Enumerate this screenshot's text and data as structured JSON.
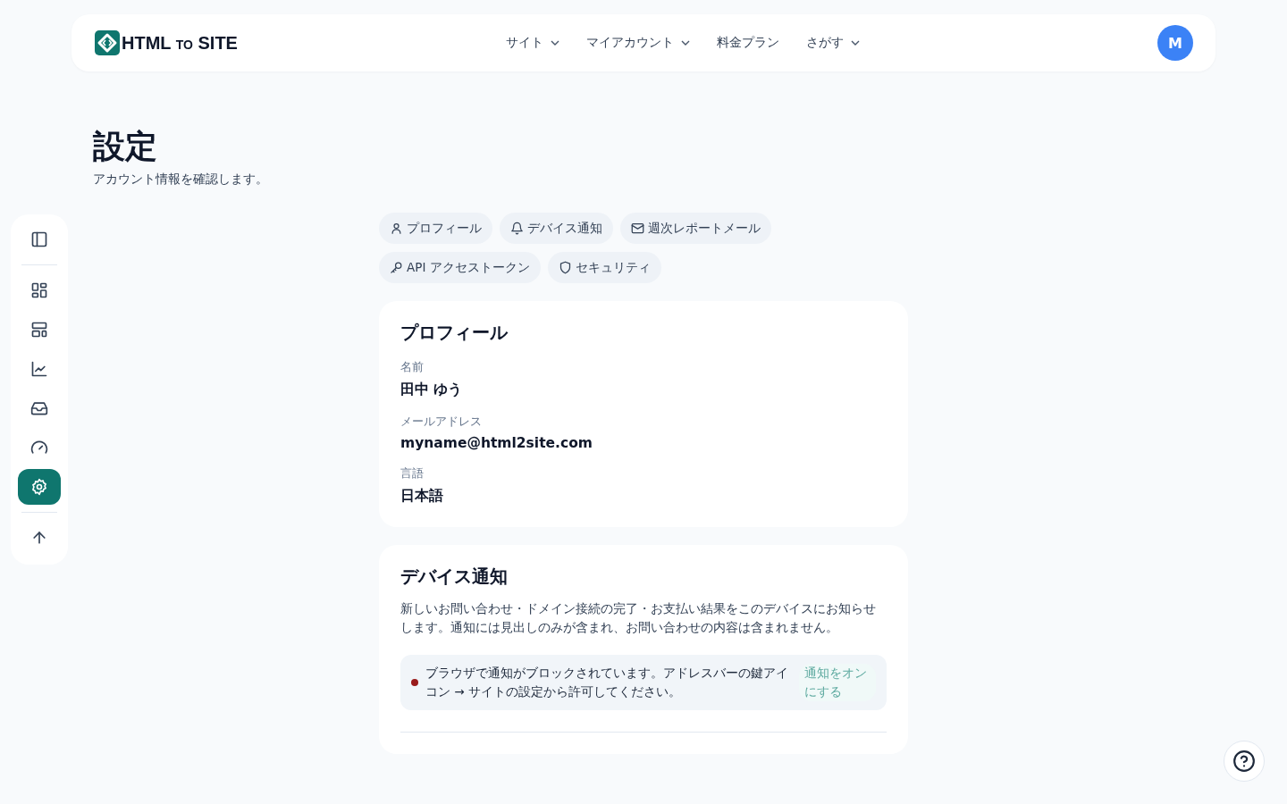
{
  "header": {
    "logo": {
      "main": "HTML",
      "small": "TO",
      "tail": "SITE"
    },
    "nav": [
      {
        "label": "サイト",
        "dropdown": true
      },
      {
        "label": "マイアカウント",
        "dropdown": true
      },
      {
        "label": "料金プラン",
        "dropdown": false
      },
      {
        "label": "さがす",
        "dropdown": true
      }
    ],
    "avatar": "M"
  },
  "page": {
    "title": "設定",
    "subtitle": "アカウント情報を確認します。"
  },
  "sidebar": {
    "groups": [
      [
        {
          "kind": "panel",
          "selected": false
        }
      ],
      [
        {
          "kind": "grid",
          "selected": false
        },
        {
          "kind": "layout",
          "selected": false
        },
        {
          "kind": "chart",
          "selected": false
        },
        {
          "kind": "inbox",
          "selected": false
        },
        {
          "kind": "gauge",
          "selected": false
        },
        {
          "kind": "settings",
          "selected": true
        }
      ],
      [
        {
          "kind": "up",
          "selected": false
        }
      ]
    ]
  },
  "tabs": [
    {
      "kind": "user",
      "label": "プロフィール"
    },
    {
      "kind": "bell",
      "label": "デバイス通知"
    },
    {
      "kind": "mail",
      "label": "週次レポートメール"
    },
    {
      "kind": "key",
      "label": "API アクセストークン"
    },
    {
      "kind": "shield",
      "label": "セキュリティ"
    }
  ],
  "profile": {
    "title": "プロフィール",
    "fields": [
      {
        "label": "名前",
        "value": "田中 ゆう"
      },
      {
        "label": "メールアドレス",
        "value": "myname@html2site.com"
      },
      {
        "label": "言語",
        "value": "日本語"
      }
    ]
  },
  "notifications": {
    "title": "デバイス通知",
    "description": "新しいお問い合わせ・ドメイン接続の完了・お支払い結果をこのデバイスにお知らせします。通知には見出しのみが含まれ、お問い合わせの内容は含まれません。",
    "alert": {
      "color": "#991b1b",
      "message": "ブラウザで通知がブロックされています。アドレスバーの鍵アイコン → サイトの設定から許可してください。",
      "button": {
        "label": "通知をオンにする",
        "disabled": true
      }
    }
  }
}
